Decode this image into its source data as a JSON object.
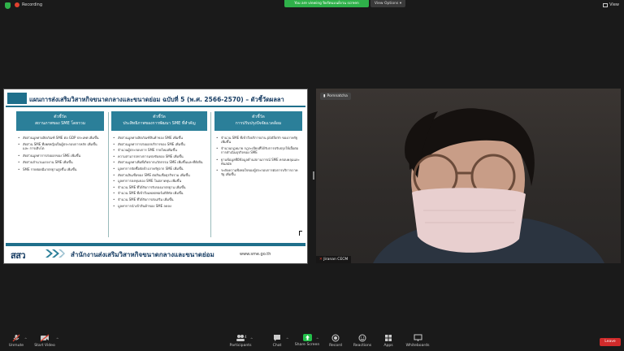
{
  "window": {
    "recording_label": "Recording",
    "viewing_banner": "You are viewing ปิยรัตนบนฝั่งวน screen",
    "view_options_label": "View Options",
    "view_label": "View"
  },
  "slide": {
    "title": "แผนการส่งเสริมวิสาหกิจขนาดกลางและขนาดย่อม ฉบับที่ 5 (พ.ศ. 2566-2570) – ตัวชี้วัดผลลา",
    "columns": [
      {
        "header_line1": "ตัวชี้วัด",
        "header_line2": "สถานภาพของ SME โดยรวม",
        "items": [
          "สัดส่วนมูลค่าผลิตภัณฑ์ SME ต่อ GDP ประเทศ เพิ่มขึ้น",
          "สัดส่วน SME ที่เพศหญิงเป็นผู้ประกอบการหลัก เพิ่มขึ้น และ การเติบโต",
          "สัดส่วนมูลค่าการส่งออกของ SME เพิ่มขึ้น",
          "สัดส่วนจำนวนแรงงาน SME เพิ่มขึ้น",
          "SME รายย่อยมีมาตรฐานสูงขึ้น เพิ่มขึ้น"
        ]
      },
      {
        "header_line1": "ตัวชี้วัด",
        "header_line2": "ประสิทธิภาพของการพัฒนา SME ที่สำคัญ",
        "items": [
          "สัดส่วนมูลค่าผลิตภัณฑ์สินค้าของ SME เพิ่มขึ้น",
          "สัดส่วนมูลค่าการส่งออกบริการของ SME เพิ่มขึ้น",
          "จำนวนผู้ประกอบการ SME รายใหม่เพิ่มขึ้น",
          "ความสามารถทางการแข่งขันของ SME เพิ่มขึ้น",
          "สัดส่วนมูลค่าเพิ่มที่เกิดจากนวัตกรรม SME เพิ่มขึ้นและที่ยั่งยืน",
          "มูลค่าการจัดซื้อจัดจ้างภาครัฐจาก SME เพิ่มขึ้น",
          "สัดส่วนสินเชื่อของ SME ต่อสินเชื่อธุรกิจรวม เพิ่มขึ้น",
          "มูลค่าการลงทุนของ SME ในตลาดทุน เพิ่มขึ้น",
          "จำนวน SME ที่ได้รับการรับรองมาตรฐาน เพิ่มขึ้น",
          "จำนวน SME ที่เข้าถึงแพลตฟอร์มดิจิทัล เพิ่มขึ้น",
          "จำนวน SME ที่ได้รับการส่งเสริม เพิ่มขึ้น",
          "มูลค่าการนำเข้าสินค้าของ SME ลดลง"
        ]
      },
      {
        "header_line1": "ตัวชี้วัด",
        "header_line2": "การปรับปรุงปัจจัยแวดล้อม",
        "items": [
          "จำนวน SME ที่เข้าถึงบริการผ่าน platform ของภาครัฐ เพิ่มขึ้น",
          "จำนวนกฎหมาย กฎระเบียบที่ได้รับการปรับปรุงให้เอื้อต่อการดำเนินธุรกิจของ SME",
          "ฐานข้อมูลที่มีข้อมูลด้านสถานการณ์ SME ครอบคลุมและทันสมัย",
          "ระดับความพึงพอใจของผู้ประกอบการต่อการบริการภาครัฐ เพิ่มขึ้น"
        ]
      }
    ],
    "footer": {
      "logo_text": "สสว",
      "agency_name": "สำนักงานส่งเสริมวิสาหกิจขนาดกลางและขนาดย่อม",
      "url": "www.sme.go.th"
    }
  },
  "video": {
    "speaker_tag": "Pornnatcha",
    "name_tag": "Jiranan CECM"
  },
  "toolbar": {
    "items": [
      {
        "label": "Unmute",
        "icon": "mic-muted-icon"
      },
      {
        "label": "Start Video",
        "icon": "video-off-icon"
      },
      {
        "label": "Participants",
        "icon": "participants-icon",
        "count": "4"
      },
      {
        "label": "Chat",
        "icon": "chat-icon"
      },
      {
        "label": "Share Screen",
        "icon": "share-screen-icon"
      },
      {
        "label": "Record",
        "icon": "record-icon"
      },
      {
        "label": "Reactions",
        "icon": "reactions-icon"
      },
      {
        "label": "Apps",
        "icon": "apps-icon"
      },
      {
        "label": "Whiteboards",
        "icon": "whiteboards-icon"
      }
    ],
    "leave_label": "Leave"
  },
  "colors": {
    "accent_green": "#23c04a",
    "leave_red": "#d02b2b",
    "slide_teal": "#2b7f99",
    "slide_navy": "#153b62"
  }
}
